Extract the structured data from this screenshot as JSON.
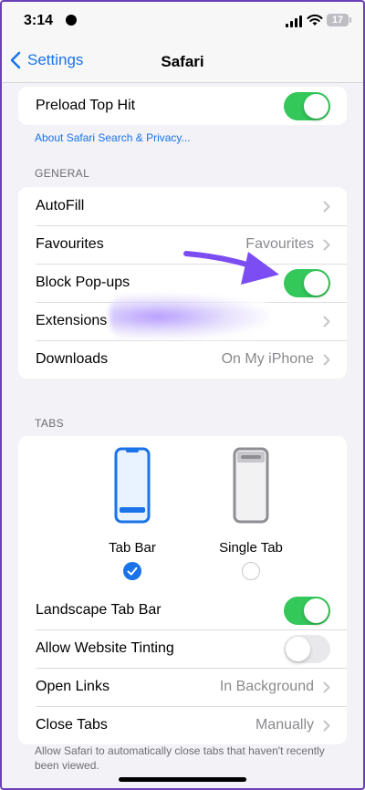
{
  "status": {
    "time": "3:14",
    "battery": "17"
  },
  "nav": {
    "back_label": "Settings",
    "title": "Safari"
  },
  "group_top": {
    "preload": {
      "label": "Preload Top Hit",
      "on": true
    }
  },
  "about_link": "About Safari Search & Privacy...",
  "general": {
    "header": "GENERAL",
    "rows": [
      {
        "label": "AutoFill",
        "value": ""
      },
      {
        "label": "Favourites",
        "value": "Favourites"
      },
      {
        "label": "Block Pop-ups",
        "toggle": true
      },
      {
        "label": "Extensions",
        "value": ""
      },
      {
        "label": "Downloads",
        "value": "On My iPhone"
      }
    ]
  },
  "tabs": {
    "header": "TABS",
    "options": [
      {
        "label": "Tab Bar",
        "selected": true
      },
      {
        "label": "Single Tab",
        "selected": false
      }
    ],
    "rows": [
      {
        "label": "Landscape Tab Bar",
        "toggle": true
      },
      {
        "label": "Allow Website Tinting",
        "toggle": false
      },
      {
        "label": "Open Links",
        "value": "In Background"
      },
      {
        "label": "Close Tabs",
        "value": "Manually"
      }
    ],
    "footer": "Allow Safari to automatically close tabs that haven't recently been viewed."
  },
  "colors": {
    "accent": "#1a73e8",
    "toggle_on": "#34c759",
    "annotation": "#7b4df2"
  }
}
